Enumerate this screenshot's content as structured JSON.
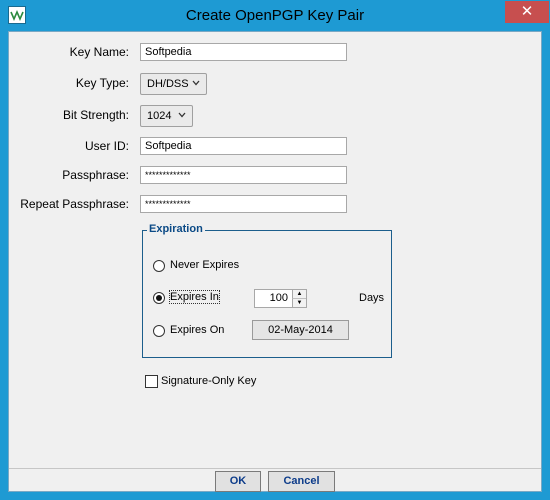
{
  "window": {
    "title": "Create OpenPGP Key Pair",
    "close_glyph": "✕"
  },
  "form": {
    "key_name_label": "Key Name:",
    "key_name_value": "Softpedia",
    "key_type_label": "Key Type:",
    "key_type_value": "DH/DSS",
    "bit_strength_label": "Bit Strength:",
    "bit_strength_value": "1024",
    "user_id_label": "User ID:",
    "user_id_value": "Softpedia",
    "passphrase_label": "Passphrase:",
    "passphrase_value": "*************",
    "repeat_passphrase_label": "Repeat Passphrase:",
    "repeat_passphrase_value": "*************"
  },
  "expiration": {
    "title": "Expiration",
    "never_label": "Never Expires",
    "expires_in_label": "Expires In",
    "expires_in_value": "100",
    "days_label": "Days",
    "expires_on_label": "Expires On",
    "expires_on_date": "02-May-2014",
    "selected": "expires_in"
  },
  "signature_only": {
    "label": "Signature-Only Key",
    "checked": false
  },
  "footer": {
    "ok_label": "OK",
    "cancel_label": "Cancel"
  },
  "colors": {
    "frame": "#1e9ad3",
    "close": "#c74f4f",
    "group_title": "#0b4a86"
  }
}
